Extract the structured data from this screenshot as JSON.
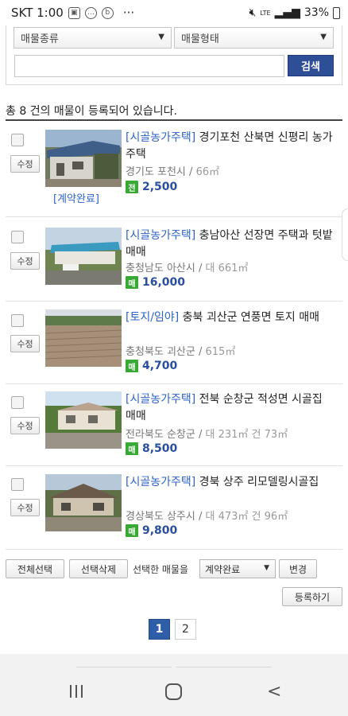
{
  "status_bar": {
    "carrier_time": "SKT 1:00",
    "dots": "···",
    "lte": "LTE",
    "battery": "33%"
  },
  "filter": {
    "type_select": "매물종류",
    "form_select": "매물형태",
    "search_value": "",
    "search_button": "검색"
  },
  "count_text": "총 8 건의 매물이 등록되어 있습니다.",
  "listings": [
    {
      "category": "[시골농가주택]",
      "title": " 경기포천 산북면 신평리 농가주택",
      "region": "경기도 포천시",
      "area": "66㎡",
      "deal_badge": "전",
      "price": "2,500",
      "status": "[계약완료]",
      "edit": "수정"
    },
    {
      "category": "[시골농가주택]",
      "title": " 충남아산 선장면 주택과 텃밭 매매",
      "region": "충청남도 아산시",
      "area": "대 661㎡",
      "deal_badge": "매",
      "price": "16,000",
      "edit": "수정"
    },
    {
      "category": "[토지/임야]",
      "title": " 충북 괴산군 연풍면 토지 매매",
      "region": "충청북도 괴산군",
      "area": "615㎡",
      "deal_badge": "매",
      "price": "4,700",
      "edit": "수정"
    },
    {
      "category": "[시골농가주택]",
      "title": " 전북 순창군 적성면 시골집 매매",
      "region": "전라북도 순창군",
      "area": "대 231㎡ 건 73㎡",
      "deal_badge": "매",
      "price": "8,500",
      "edit": "수정"
    },
    {
      "category": "[시골농가주택]",
      "title": " 경북 상주 리모델링시골집",
      "region": "경상북도 상주시",
      "area": "대 473㎡ 건 96㎡",
      "deal_badge": "매",
      "price": "9,800",
      "edit": "수정"
    }
  ],
  "actions": {
    "select_all": "전체선택",
    "delete_selected": "선택삭제",
    "selected_label": "선택한 매물을",
    "status_option": "계약완료",
    "change": "변경",
    "register": "등록하기"
  },
  "pagination": {
    "pages": [
      "1",
      "2"
    ],
    "current": "1"
  },
  "colors": {
    "accent": "#2e4f95",
    "link": "#2d63c8",
    "badge": "#39a935"
  }
}
